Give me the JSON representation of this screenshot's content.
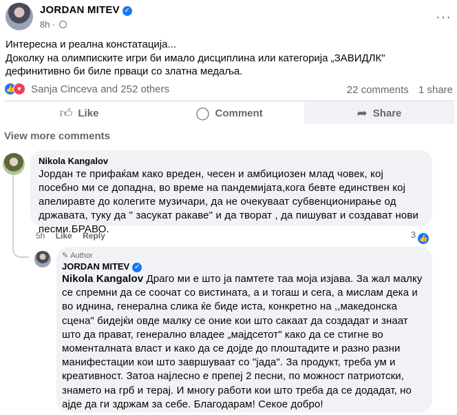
{
  "post": {
    "author": "JORDAN MITEV",
    "time": "8h",
    "more_label": "···",
    "text_lines": [
      "Интересна и реална констатација...",
      "Доколку на олимписките игри би имало дисциплина или категорија „ЗАВИДЛК\" дефинитивно би биле прваци со златна медаља."
    ]
  },
  "reactions": {
    "names": "Sanja Cinceva and 252 others",
    "comments": "22 comments",
    "shares": "1 share"
  },
  "actions": {
    "like": "Like",
    "comment": "Comment",
    "share": "Share"
  },
  "view_more": "View more comments",
  "comment": {
    "author": "Nikola Kangalov",
    "text": "Јордан те прифаќам како вреден, чесен и амбициозен млад човек, кој посебно ми се допадна, во време на пандемијата,кога бевте единствен кој апелиравте до колегите музичари, да не очекуваат субвенционирање од државата, туку да \" засукат ракаве\" и да творат , да пишуват и создават нови песми.БРАВО.",
    "time": "5h",
    "like_btn": "Like",
    "reply_btn": "Reply",
    "like_count": "3"
  },
  "reply": {
    "badge": "Author",
    "author": "JORDAN MITEV",
    "mention": "Nikola Kangalov",
    "text": " Драго ми е што ја памтете таа моја изјава. За жал малку се спремни да се соочат со вистината, а и тогаш и сега, а мислам дека и во иднина, генерална слика ќе биде иста, конкретно на ,,македонска сцена\" бидејќи овде малку се оние кои што сакаат да создадат и знаат што да прават, генерално владее „мајдсетот\" како да се стигне во моменталната власт и како да се дојде до плоштадите и разно разни манифестации кои што завршуваат со \"јада\". За продукт, треба ум и креативност. Затоа најлесно е препеј 2 песни, по можност патриотски, знамето на грб и терај. И многу работи кои што треба да се додадат, но ајде да ги здржам за себе. Благодарам! Секое добро!"
  },
  "colors": {
    "accent": "#1877f2",
    "love": "#f33e58",
    "muted": "#65676b",
    "bubble": "#f0f2f5"
  },
  "icons": [
    "verified-icon",
    "globe-icon",
    "more-icon",
    "like-icon",
    "comment-icon",
    "share-icon",
    "pen-icon"
  ]
}
